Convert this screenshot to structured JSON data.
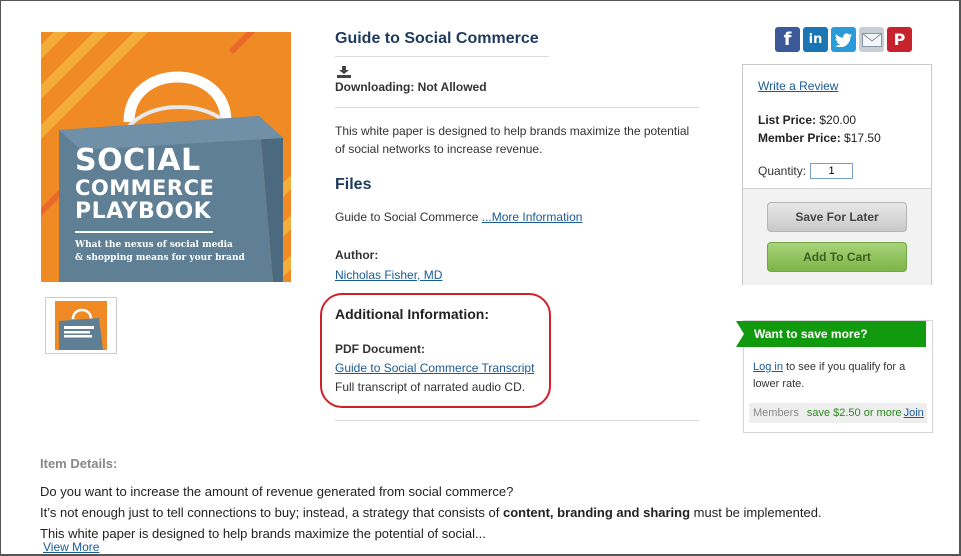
{
  "product": {
    "title": "Guide to Social Commerce",
    "downloading": "Downloading: Not Allowed",
    "description": "This white paper is designed to help brands maximize the potential of social networks to increase revenue.",
    "cover": {
      "line1": "SOCIAL",
      "line2": "COMMERCE",
      "line3": "PLAYBOOK",
      "subtitle_line1": "What the nexus of social media",
      "subtitle_line2": "& shopping means for your brand"
    }
  },
  "files": {
    "heading": "Files",
    "item_name": "Guide to Social Commerce",
    "more_info_link": "...More Information"
  },
  "author": {
    "heading": "Author:",
    "name": "Nicholas Fisher, MD"
  },
  "additional": {
    "heading": "Additional Information:",
    "pdf_heading": "PDF Document:",
    "pdf_link": "Guide to Social Commerce Transcript",
    "pdf_desc": "Full transcript of narrated audio CD."
  },
  "social": [
    "facebook-icon",
    "linkedin-icon",
    "twitter-icon",
    "email-icon",
    "pinterest-icon"
  ],
  "buy": {
    "review_link": "Write a Review",
    "list_price_label": "List Price:",
    "list_price": "$20.00",
    "member_price_label": "Member Price:",
    "member_price": "$17.50",
    "quantity_label": "Quantity:",
    "quantity_value": "1",
    "save_later": "Save For Later",
    "add_to_cart": "Add To Cart"
  },
  "save_more": {
    "banner": "Want to save more?",
    "login_link": "Log in",
    "login_text": " to see if you qualify for a lower rate.",
    "members_label": "Members",
    "savings": "save $2.50 or more",
    "join_link": "Join"
  },
  "item_details": {
    "heading": "Item Details:",
    "line1": "Do you want to increase the amount of revenue generated from social commerce?",
    "line2_pre": "It’s not enough just to tell connections to buy; instead, a strategy that consists of ",
    "line2_bold": "content, branding and sharing",
    "line2_post": " must be implemented.",
    "line3": "This white paper is designed to help brands maximize the potential of social...",
    "view_more": "View More"
  },
  "colors": {
    "title_blue": "#1e3a5c",
    "link_blue": "#1a5a96",
    "green_banner": "#129a0f",
    "highlight_red": "#d0202a",
    "cover_orange": "#f08a24",
    "cover_bag": "#5f7f95"
  }
}
